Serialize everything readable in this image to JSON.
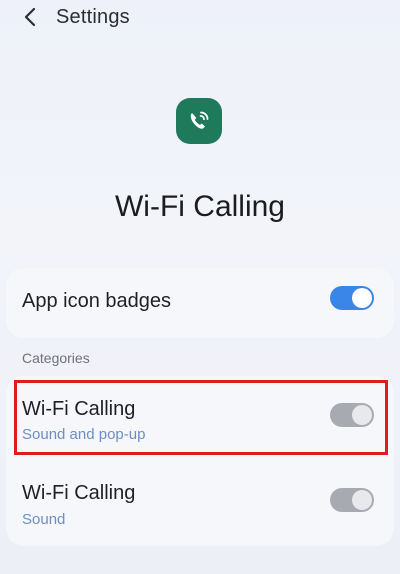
{
  "header": {
    "back_icon": "chevron-left-icon",
    "title": "Settings"
  },
  "app": {
    "icon": "wifi-calling-phone-icon",
    "icon_color": "#1f7a5b",
    "name": "Wi-Fi Calling"
  },
  "app_icon_badges": {
    "label": "App icon badges",
    "toggle_on": true
  },
  "categories": {
    "header": "Categories",
    "items": [
      {
        "title": "Wi-Fi Calling",
        "subtitle": "Sound and pop-up",
        "toggle_on": true,
        "highlighted": true
      },
      {
        "title": "Wi-Fi Calling",
        "subtitle": "Sound",
        "toggle_on": true,
        "highlighted": false
      }
    ]
  },
  "colors": {
    "accent": "#3a86e8",
    "subtitle": "#6b8ec4",
    "highlight": "#e01b1b"
  }
}
